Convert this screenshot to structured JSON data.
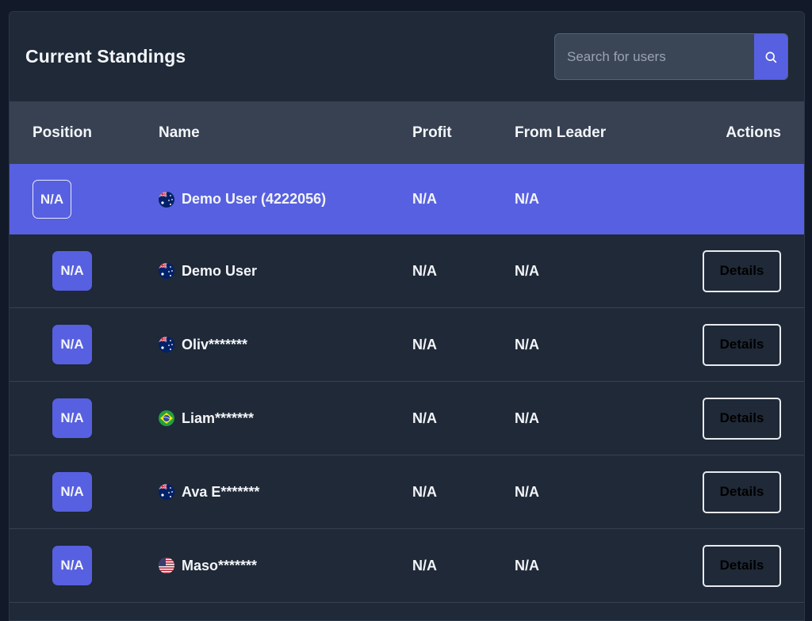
{
  "panel": {
    "title": "Current Standings",
    "search": {
      "placeholder": "Search for users",
      "icon": "search-icon"
    }
  },
  "table": {
    "headers": {
      "position": "Position",
      "name": "Name",
      "profit": "Profit",
      "from_leader": "From Leader",
      "actions": "Actions"
    },
    "current_user": {
      "position": "N/A",
      "flag": "australia-flag-icon",
      "name": "Demo User (4222056)",
      "profit": "N/A",
      "from_leader": "N/A"
    },
    "rows": [
      {
        "position": "N/A",
        "flag": "australia-flag-icon",
        "name": "Demo User",
        "profit": "N/A",
        "from_leader": "N/A",
        "action": "Details"
      },
      {
        "position": "N/A",
        "flag": "australia-flag-icon",
        "name": "Oliv*******",
        "profit": "N/A",
        "from_leader": "N/A",
        "action": "Details"
      },
      {
        "position": "N/A",
        "flag": "brazil-flag-icon",
        "name": "Liam*******",
        "profit": "N/A",
        "from_leader": "N/A",
        "action": "Details"
      },
      {
        "position": "N/A",
        "flag": "australia-flag-icon",
        "name": "Ava E*******",
        "profit": "N/A",
        "from_leader": "N/A",
        "action": "Details"
      },
      {
        "position": "N/A",
        "flag": "usa-flag-icon",
        "name": "Maso*******",
        "profit": "N/A",
        "from_leader": "N/A",
        "action": "Details"
      }
    ]
  },
  "colors": {
    "page_bg": "#121a2a",
    "panel_bg": "#1f2937",
    "header_bg": "#374151",
    "accent": "#5760e0",
    "text": "#f3f5f9"
  }
}
